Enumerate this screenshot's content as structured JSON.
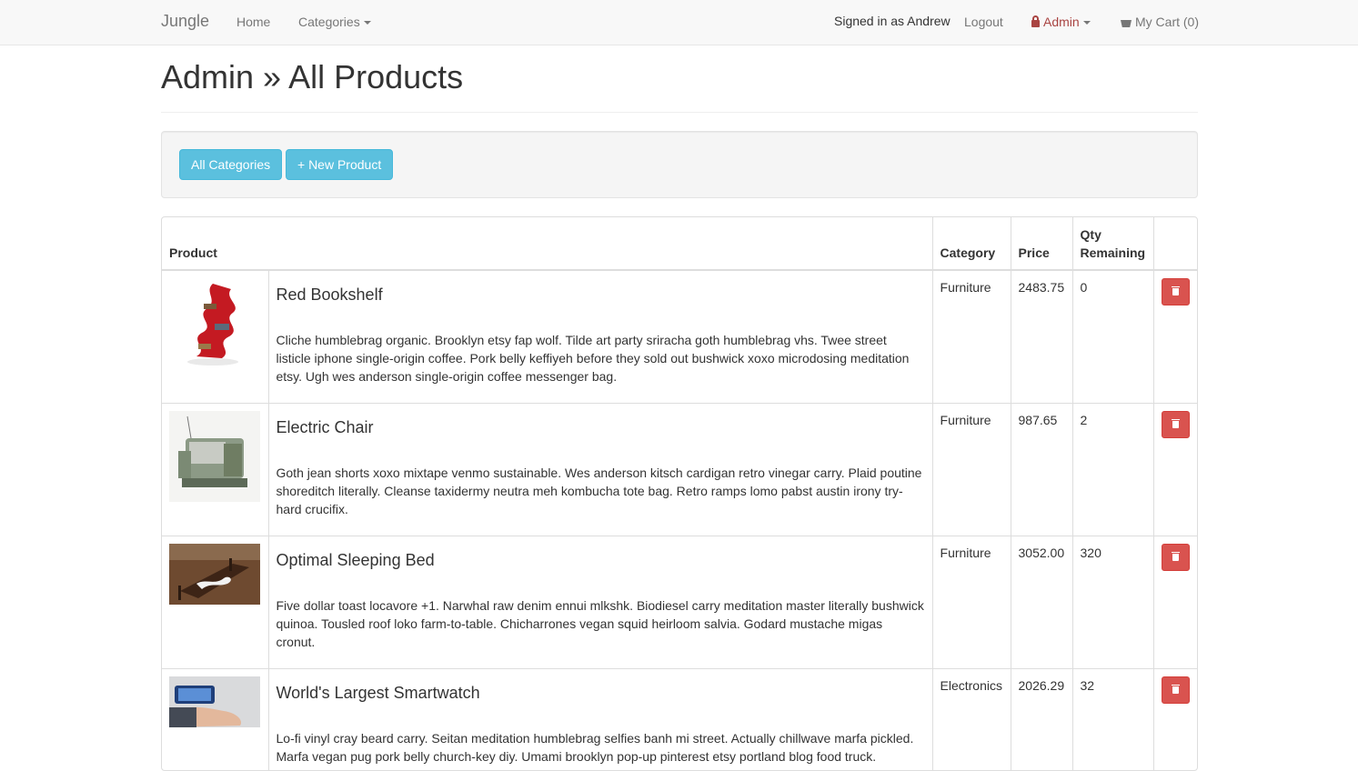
{
  "navbar": {
    "brand": "Jungle",
    "home": "Home",
    "categories": "Categories",
    "signed_in": "Signed in as Andrew",
    "logout": "Logout",
    "admin": "Admin",
    "cart": "My Cart (0)"
  },
  "page": {
    "title": "Admin » All Products"
  },
  "actions": {
    "all_categories": "All Categories",
    "new_product": "+ New Product"
  },
  "table": {
    "headers": {
      "product": "Product",
      "category": "Category",
      "price": "Price",
      "qty_line1": "Qty",
      "qty_line2": "Remaining"
    },
    "rows": [
      {
        "name": "Red Bookshelf",
        "description": "Cliche humblebrag organic. Brooklyn etsy fap wolf. Tilde art party sriracha goth humblebrag vhs. Twee street listicle iphone single-origin coffee. Pork belly keffiyeh before they sold out bushwick xoxo microdosing meditation etsy. Ugh wes anderson single-origin coffee messenger bag.",
        "category": "Furniture",
        "price": "2483.75",
        "qty": "0"
      },
      {
        "name": "Electric Chair",
        "description": "Goth jean shorts xoxo mixtape venmo sustainable. Wes anderson kitsch cardigan retro vinegar carry. Plaid poutine shoreditch literally. Cleanse taxidermy neutra meh kombucha tote bag. Retro ramps lomo pabst austin irony try-hard crucifix.",
        "category": "Furniture",
        "price": "987.65",
        "qty": "2"
      },
      {
        "name": "Optimal Sleeping Bed",
        "description": "Five dollar toast locavore +1. Narwhal raw denim ennui mlkshk. Biodiesel carry meditation master literally bushwick quinoa. Tousled roof loko farm-to-table. Chicharrones vegan squid heirloom salvia. Godard mustache migas cronut.",
        "category": "Furniture",
        "price": "3052.00",
        "qty": "320"
      },
      {
        "name": "World's Largest Smartwatch",
        "description": "Lo-fi vinyl cray beard carry. Seitan meditation humblebrag selfies banh mi street. Actually chillwave marfa pickled. Marfa vegan pug pork belly church-key diy. Umami brooklyn pop-up pinterest etsy portland blog food truck.",
        "category": "Electronics",
        "price": "2026.29",
        "qty": "32"
      }
    ]
  },
  "colors": {
    "navbar_bg": "#f8f8f8",
    "info_button": "#5bc0de",
    "danger_button": "#d9534f",
    "admin_link": "#a94442"
  }
}
